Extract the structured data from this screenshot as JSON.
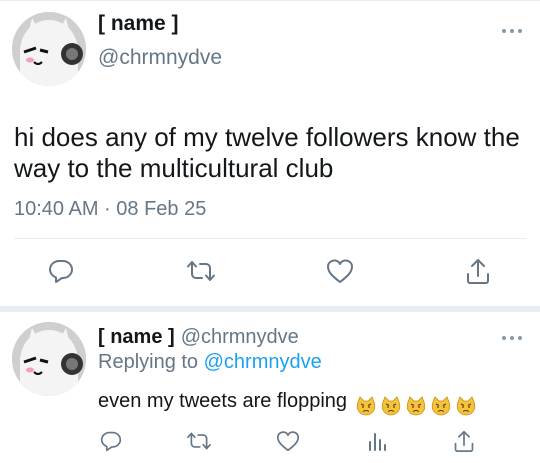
{
  "main_tweet": {
    "display_name": "[ name ]",
    "handle": "@chrmnydve",
    "text": "hi does any of my twelve followers know the way to the multicultural club",
    "timestamp": "10:40 AM · 08 Feb 25",
    "actions": [
      "reply-icon",
      "retweet-icon",
      "like-icon",
      "share-icon"
    ]
  },
  "reply_tweet": {
    "display_name": "[ name ]",
    "handle": "@chrmnydve",
    "replying_prefix": "Replying to",
    "replying_to": "@chrmnydve",
    "text": "even my tweets are flopping",
    "emoji": [
      "pouting-cat-emoji",
      "pouting-cat-emoji",
      "pouting-cat-emoji",
      "pouting-cat-emoji",
      "pouting-cat-emoji"
    ],
    "actions": [
      "reply-icon",
      "retweet-icon",
      "like-icon",
      "analytics-icon",
      "share-icon"
    ]
  },
  "colors": {
    "text": "#14171a",
    "secondary": "#657786",
    "link": "#1da1f2",
    "divider": "#e6ecf0"
  }
}
